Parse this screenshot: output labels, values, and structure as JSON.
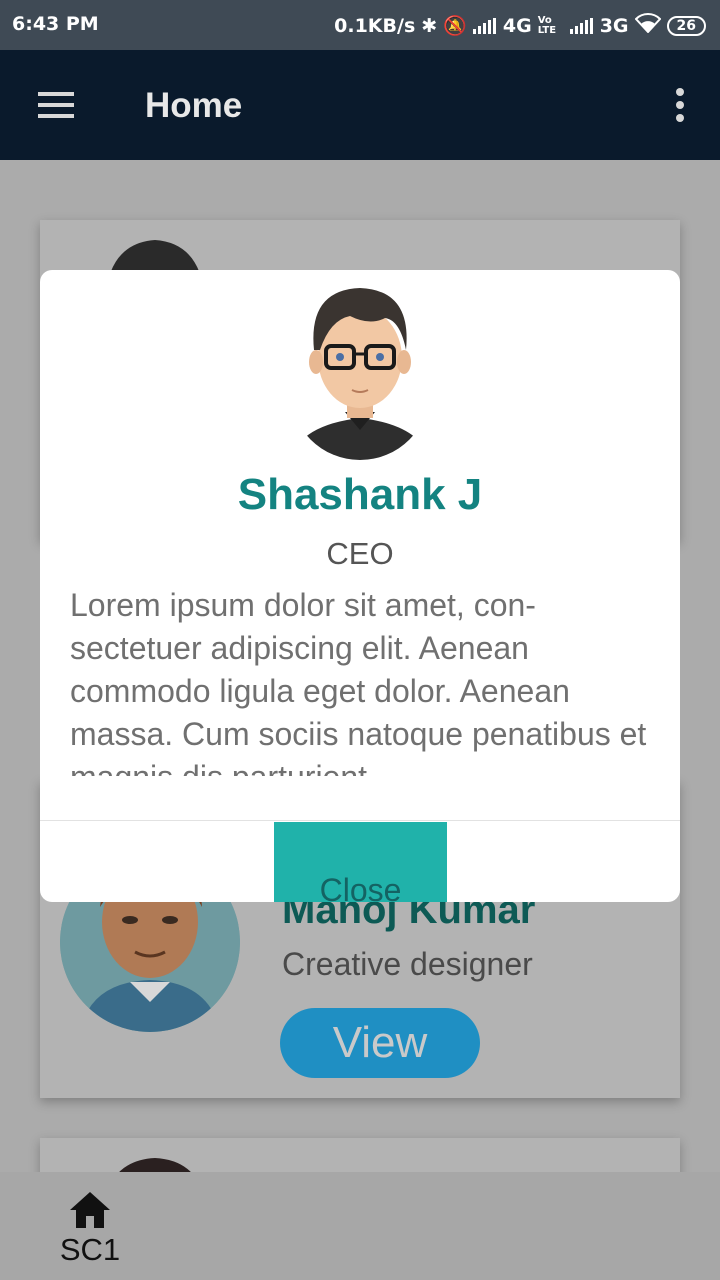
{
  "status_bar": {
    "time": "6:43 PM",
    "net_speed": "0.1KB/s",
    "net1": "4G",
    "volte": "Vo LTE",
    "net2": "3G",
    "battery": "26"
  },
  "app_bar": {
    "title": "Home"
  },
  "cards": [
    {
      "name": "Manoj Kumar",
      "role": "Creative designer",
      "button": "View"
    }
  ],
  "modal": {
    "name": "Shashank J",
    "role": "CEO",
    "description": "Lorem ipsum dolor sit amet, con- sectetuer adipiscing elit. Aenean commodo ligula eget dolor. Aenean massa. Cum sociis natoque penatibus et magnis dis parturient",
    "close_label": "Close"
  },
  "bottom_nav": {
    "tab_label": "SC1",
    "tab_icon": "home-icon"
  },
  "colors": {
    "accent": "#148381",
    "button": "#20b2aa",
    "appbar": "#0a1a2c"
  }
}
